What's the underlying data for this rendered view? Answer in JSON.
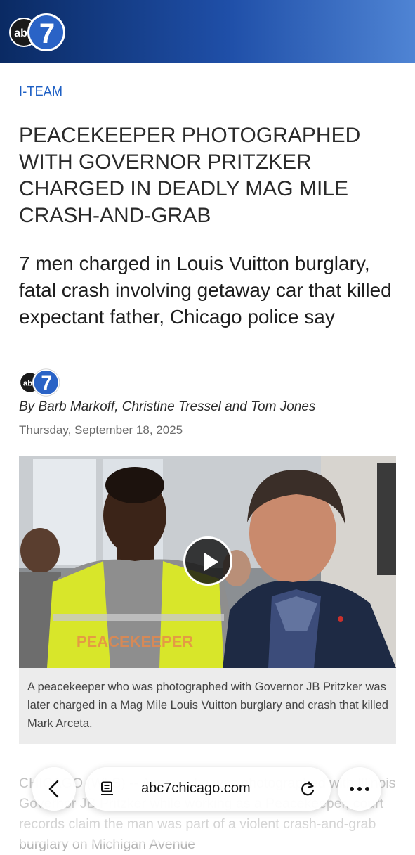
{
  "header": {
    "logo_text": "abc",
    "logo_numeral": "7"
  },
  "article": {
    "section": "I-TEAM",
    "headline": "PEACEKEEPER PHOTOGRAPHED WITH GOVERNOR PRITZKER CHARGED IN DEADLY MAG MILE CRASH-AND-GRAB",
    "subhead": "7 men charged in Louis Vuitton burglary, fatal crash involving getaway car that killed expectant father, Chicago police say",
    "byline": "By Barb Markoff, Christine Tressel and Tom Jones",
    "date": "Thursday, September 18, 2025",
    "caption": "A peacekeeper who was photographed with Governor JB Pritzker was later charged in a Mag Mile Louis Vuitton burglary and crash that killed Mark Arceta.",
    "body_preview": "CHICAGO (WLS) -- A man who was photographed with Illinois Governor JB Pritzker while working as a Peacekeeper, court records claim the man was part of a violent crash-and-grab burglary on Michigan Avenue"
  },
  "media": {
    "vest_text": "PEACEKEEPER"
  },
  "browser": {
    "url": "abc7chicago.com",
    "icons": [
      "chevron-left-icon",
      "reader-icon",
      "reload-icon",
      "more-icon"
    ]
  },
  "colors": {
    "header_dark": "#0a2a63",
    "header_light": "#4f84d4",
    "section": "#1d5fc4"
  }
}
